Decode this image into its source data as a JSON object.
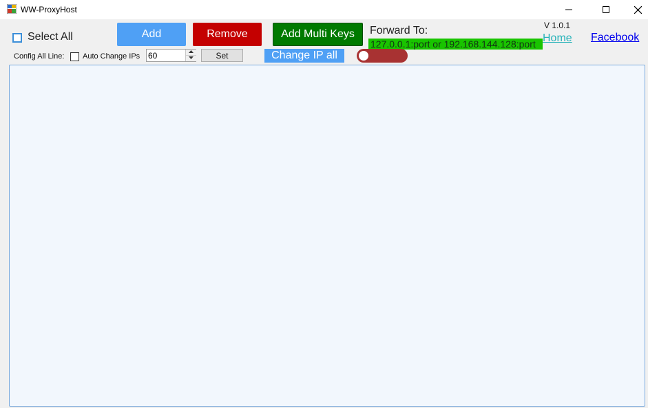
{
  "window": {
    "title": "WW-ProxyHost",
    "controls": [
      "minimize-icon",
      "maximize-icon",
      "close-icon"
    ]
  },
  "toolbar": {
    "select_all_label": "Select All",
    "add_label": "Add",
    "remove_label": "Remove",
    "add_multi_keys_label": "Add Multi Keys",
    "forward_label": "Forward To:",
    "forward_value": "127.0.0.1:port or 192.168.144.128:port",
    "version": "V 1.0.1",
    "home_link": "Home",
    "facebook_link": "Facebook"
  },
  "config": {
    "config_all_line_label": "Config All Line:",
    "auto_change_label": "Auto Change IPs",
    "auto_change_checked": false,
    "interval_value": "60",
    "set_label": "Set",
    "change_ip_all_label": "Change IP all",
    "toggle_on": false
  },
  "colors": {
    "add": "#4fa0f5",
    "remove": "#c40000",
    "add_multi": "#007a00",
    "forward_bg": "#19c400",
    "toggle_off": "#a83232",
    "home_link": "#27b3b9",
    "facebook_link": "#0000ee"
  }
}
